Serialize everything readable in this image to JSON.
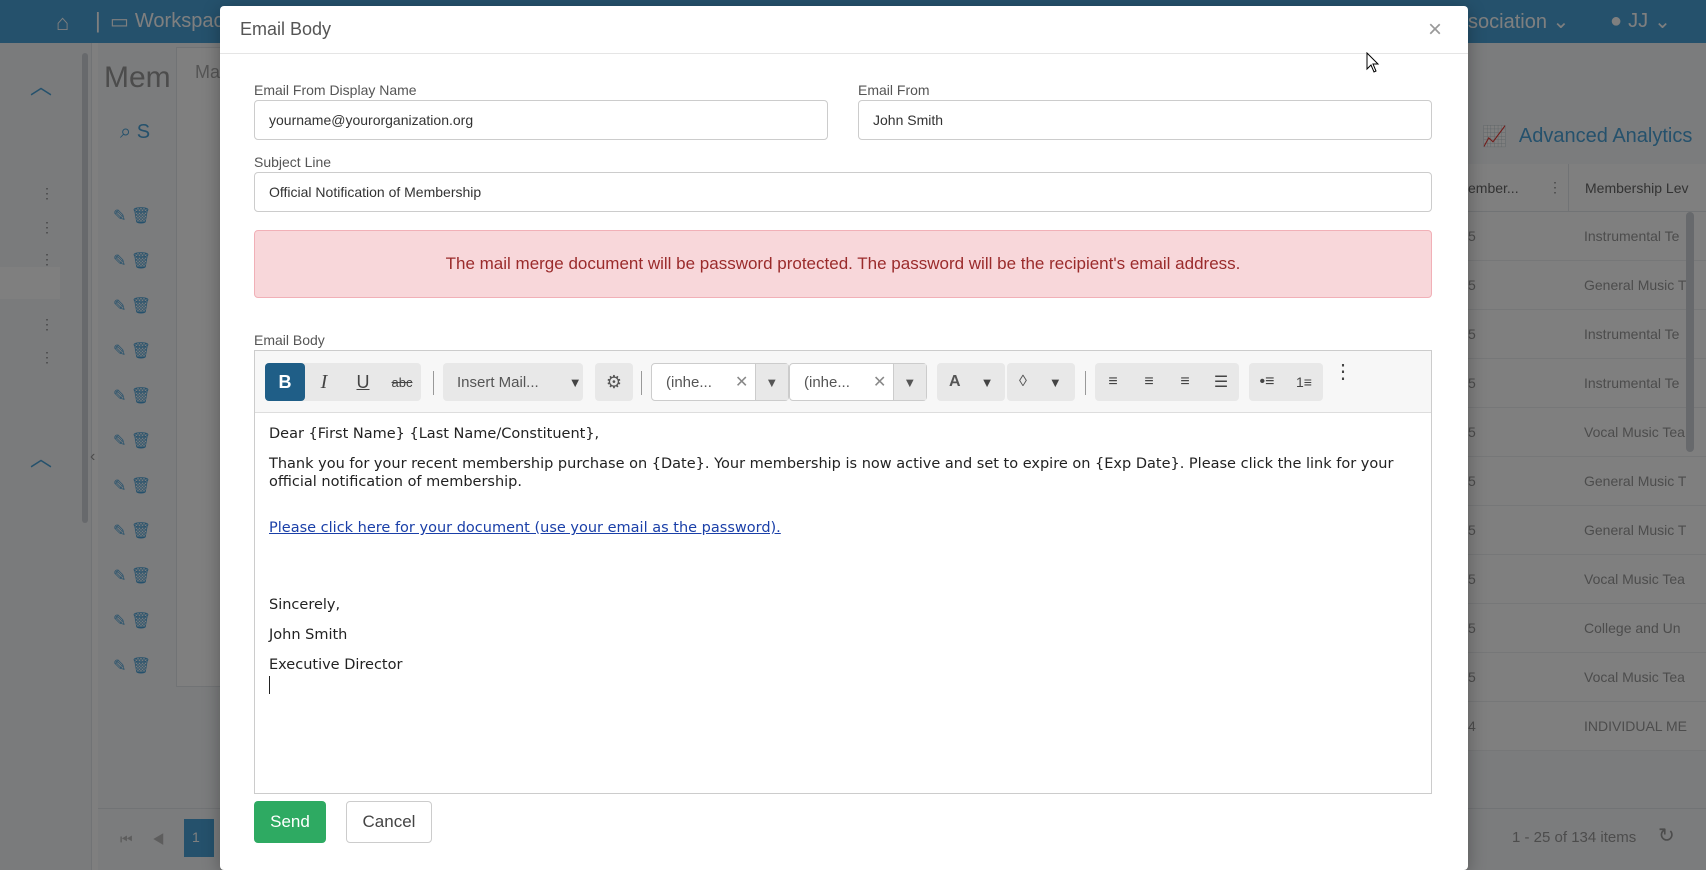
{
  "background": {
    "workspace_label": "Workspac",
    "association_label": "ssociation",
    "user_initials": "JJ",
    "page_title": "Mem",
    "search_text": "S",
    "inner_panel_text": "Ma",
    "advanced_analytics": "Advanced Analytics",
    "col_header_1": "ember...",
    "col_header_2": "Membership Lev",
    "rows": [
      {
        "c1": "5",
        "c2": "Instrumental Te"
      },
      {
        "c1": "5",
        "c2": "General Music T"
      },
      {
        "c1": "5",
        "c2": "Instrumental Te"
      },
      {
        "c1": "5",
        "c2": "Instrumental Te"
      },
      {
        "c1": "5",
        "c2": "Vocal Music Tea"
      },
      {
        "c1": "5",
        "c2": "General Music T"
      },
      {
        "c1": "5",
        "c2": "General Music T"
      },
      {
        "c1": "5",
        "c2": "Vocal Music Tea"
      },
      {
        "c1": "5",
        "c2": "College and Un"
      },
      {
        "c1": "5",
        "c2": "Vocal Music Tea"
      },
      {
        "c1": "4",
        "c2": "INDIVIDUAL ME"
      }
    ],
    "pager_page": "1",
    "pager_count": "1 - 25 of 134 items"
  },
  "modal": {
    "title": "Email Body",
    "close_glyph": "×",
    "from_display_label": "Email From Display Name",
    "from_display_value": "yourname@yourorganization.org",
    "from_label": "Email From",
    "from_value": "John Smith",
    "subject_label": "Subject Line",
    "subject_value": "Official Notification of Membership",
    "alert_text": "The mail merge document will be password protected. The password will be the recipient's email address.",
    "body_label": "Email Body",
    "toolbar": {
      "bold": "B",
      "italic": "I",
      "underline": "U",
      "strike": "abc",
      "insert_mail": "Insert Mail...",
      "font_family": "(inhe...",
      "font_size": "(inhe...",
      "font_color": "A",
      "more": "⋮"
    },
    "body": {
      "greeting": "Dear {First Name} {Last Name/Constituent},",
      "paragraph": "Thank you for your recent membership purchase on {Date}. Your membership is now active and set to expire on {Exp Date}. Please click the link for your official notification of membership.",
      "link_text": "Please click here for your document (use your email as the password).",
      "closing": "Sincerely,",
      "sender_name": "John Smith",
      "sender_title": "Executive Director"
    },
    "send_label": "Send",
    "cancel_label": "Cancel"
  },
  "colors": {
    "brand_blue": "#4aa3d9",
    "send_green": "#2eaa62",
    "alert_bg": "#f8d7da",
    "alert_text": "#9a2b2b",
    "bold_active": "#1f5e87"
  }
}
